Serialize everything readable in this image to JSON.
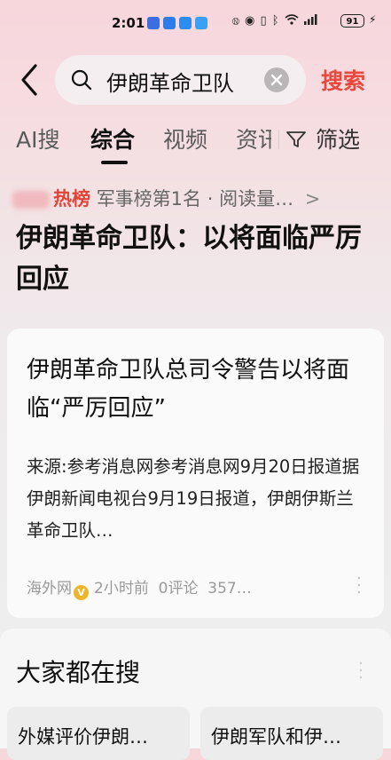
{
  "status_bar": {
    "time": "2:01",
    "battery": "91",
    "icons": [
      "nfc-icon",
      "eye-icon",
      "vibrate-icon",
      "bluetooth-icon",
      "wifi-icon",
      "signal-icon",
      "battery-icon"
    ]
  },
  "search": {
    "query": "伊朗革命卫队",
    "submit_label": "搜索"
  },
  "tabs": [
    {
      "label": "AI搜",
      "active": false
    },
    {
      "label": "综合",
      "active": true
    },
    {
      "label": "视频",
      "active": false
    },
    {
      "label": "资讯",
      "active": false
    }
  ],
  "filter_label": "筛选",
  "hot": {
    "badge": "热榜",
    "rank": "军事榜第1名",
    "separator": "·",
    "reads": "阅读量…",
    "arrow": ">",
    "headline": "伊朗革命卫队：以将面临严厉回应"
  },
  "result": {
    "title": "伊朗革命卫队总司令警告以将面临“严厉回应”",
    "snippet": "来源:参考消息网参考消息网9月20日报道据伊朗新闻电视台9月19日报道，伊朗伊斯兰革命卫队…",
    "source": "海外网",
    "time": "2小时前",
    "comments": "0评论",
    "views": "357…"
  },
  "everyone_search": {
    "title": "大家都在搜",
    "items": [
      "外媒评价伊朗…",
      "伊朗军队和伊…"
    ]
  },
  "colors": {
    "accent_red": "#e9483d",
    "hot_badge": "#e24437",
    "verified": "#f0b429"
  }
}
